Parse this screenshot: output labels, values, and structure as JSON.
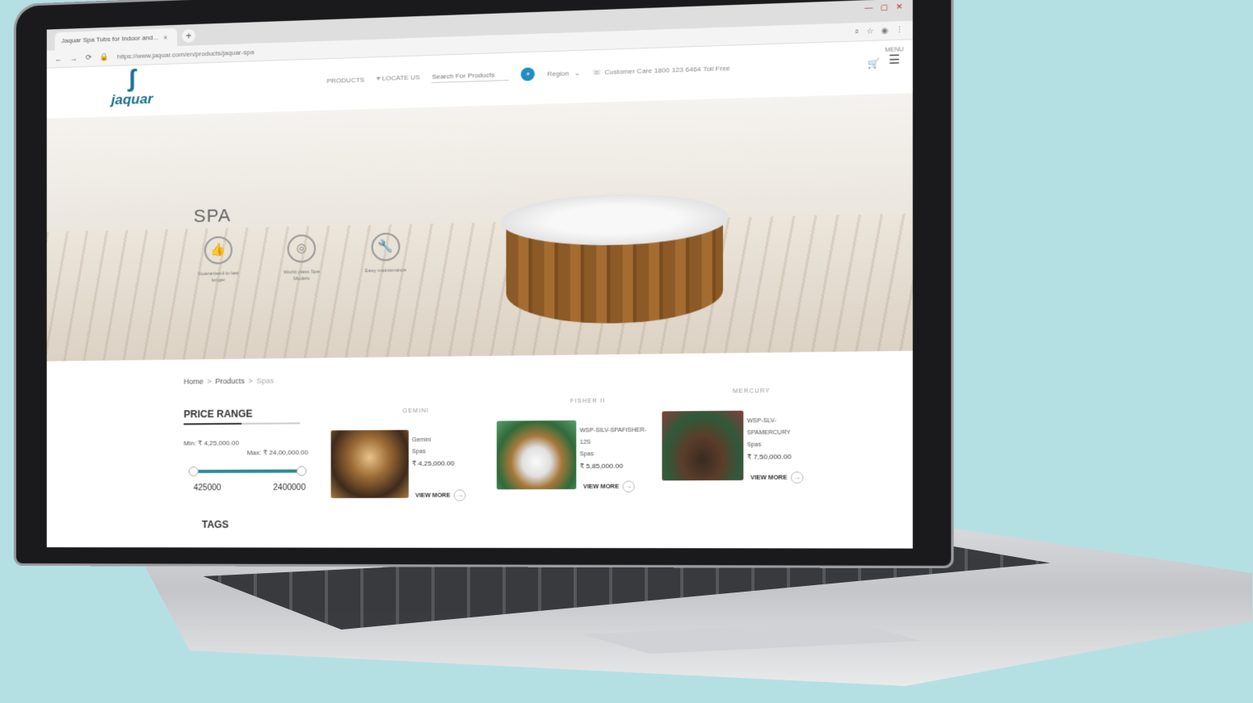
{
  "browser": {
    "tab_title": "Jaquar Spa Tubs for Indoor and...",
    "tab_close": "×",
    "new_tab": "+",
    "url": "https://www.jaquar.com/en/products/jaquar-spa"
  },
  "header": {
    "logo_text": "jaquar",
    "nav_products": "PRODUCTS",
    "nav_locate": "LOCATE US",
    "search_placeholder": "Search For Products",
    "region_label": "Region",
    "customer_care": "Customer Care 1800 123 6464 Toll Free",
    "menu_label": "MENU"
  },
  "hero": {
    "title": "SPA",
    "features": [
      {
        "icon": "thumbs-up-icon",
        "label": "Guaranteed to last longer"
      },
      {
        "icon": "jets-icon",
        "label": "World class Spa Models"
      },
      {
        "icon": "wrench-icon",
        "label": "Easy maintenance"
      }
    ]
  },
  "breadcrumb": {
    "home": "Home",
    "sep": ">",
    "products": "Products",
    "current": "Spas"
  },
  "filter": {
    "price_title": "PRICE RANGE",
    "min_text": "Min: ₹ 4,25,000.00",
    "max_text": "Max: ₹ 24,00,000.00",
    "range_min": "425000",
    "range_max": "2400000",
    "tags_title": "TAGS"
  },
  "products": [
    {
      "heading": "GEMINI",
      "name": "Gemini",
      "category": "Spas",
      "price": "₹ 4,25,000.00",
      "view_more": "VIEW MORE"
    },
    {
      "heading": "FISHER II",
      "name": "WSP-SILV-SPAFISHER-12S",
      "category": "Spas",
      "price": "₹ 5,85,000.00",
      "view_more": "VIEW MORE"
    },
    {
      "heading": "MERCURY",
      "name": "WSP-SLV-SPAMERCURY",
      "category": "Spas",
      "price": "₹ 7,50,000.00",
      "view_more": "VIEW MORE"
    }
  ],
  "colors": {
    "background": "#b5e0e3",
    "brand": "#1b6e8f",
    "accent": "#1f8ec4",
    "slider": "#2a8aa0"
  }
}
